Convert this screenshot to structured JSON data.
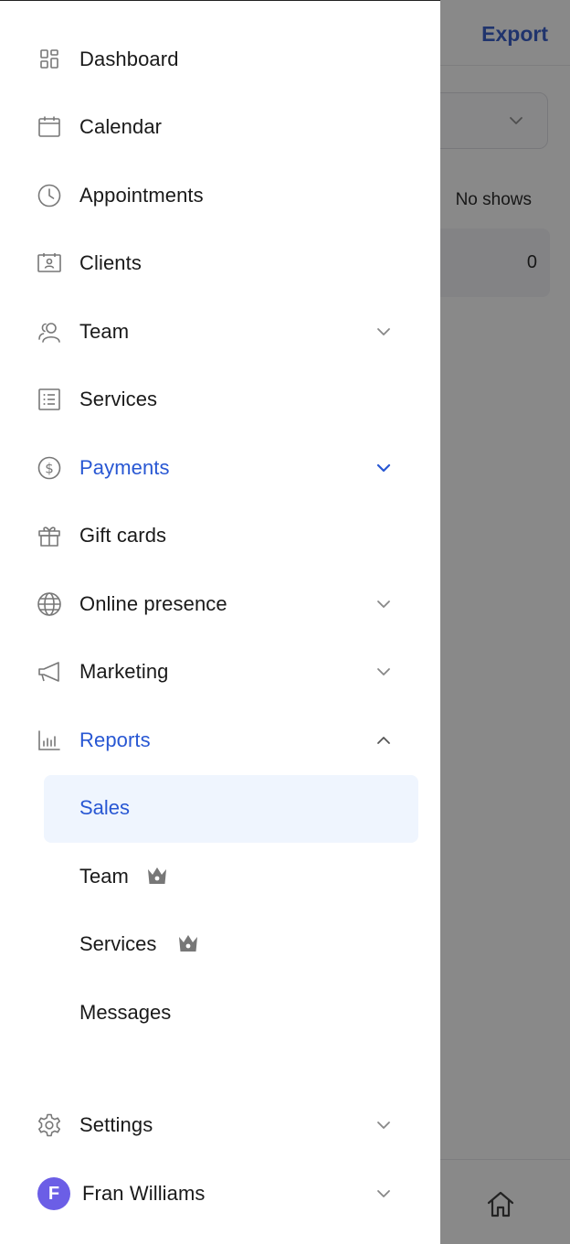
{
  "background": {
    "export_label": "Export",
    "column_header": "No shows",
    "row_value": "0"
  },
  "nav": {
    "items": [
      {
        "label": "Dashboard",
        "icon": "dashboard-icon"
      },
      {
        "label": "Calendar",
        "icon": "calendar-icon"
      },
      {
        "label": "Appointments",
        "icon": "clock-icon"
      },
      {
        "label": "Clients",
        "icon": "client-card-icon"
      },
      {
        "label": "Team",
        "icon": "team-icon"
      },
      {
        "label": "Services",
        "icon": "services-list-icon"
      },
      {
        "label": "Payments",
        "icon": "dollar-circle-icon"
      },
      {
        "label": "Gift cards",
        "icon": "gift-icon"
      },
      {
        "label": "Online presence",
        "icon": "globe-icon"
      },
      {
        "label": "Marketing",
        "icon": "megaphone-icon"
      },
      {
        "label": "Reports",
        "icon": "bar-chart-icon"
      }
    ],
    "reports_sub": [
      {
        "label": "Sales"
      },
      {
        "label": "Team"
      },
      {
        "label": "Services"
      },
      {
        "label": "Messages"
      }
    ],
    "settings_label": "Settings",
    "user": {
      "initial": "F",
      "name": "Fran Williams"
    }
  },
  "colors": {
    "accent": "#2857d3",
    "selected_bg": "#eff5fe",
    "avatar": "#6b5ee6",
    "export": "#2c54c6"
  }
}
